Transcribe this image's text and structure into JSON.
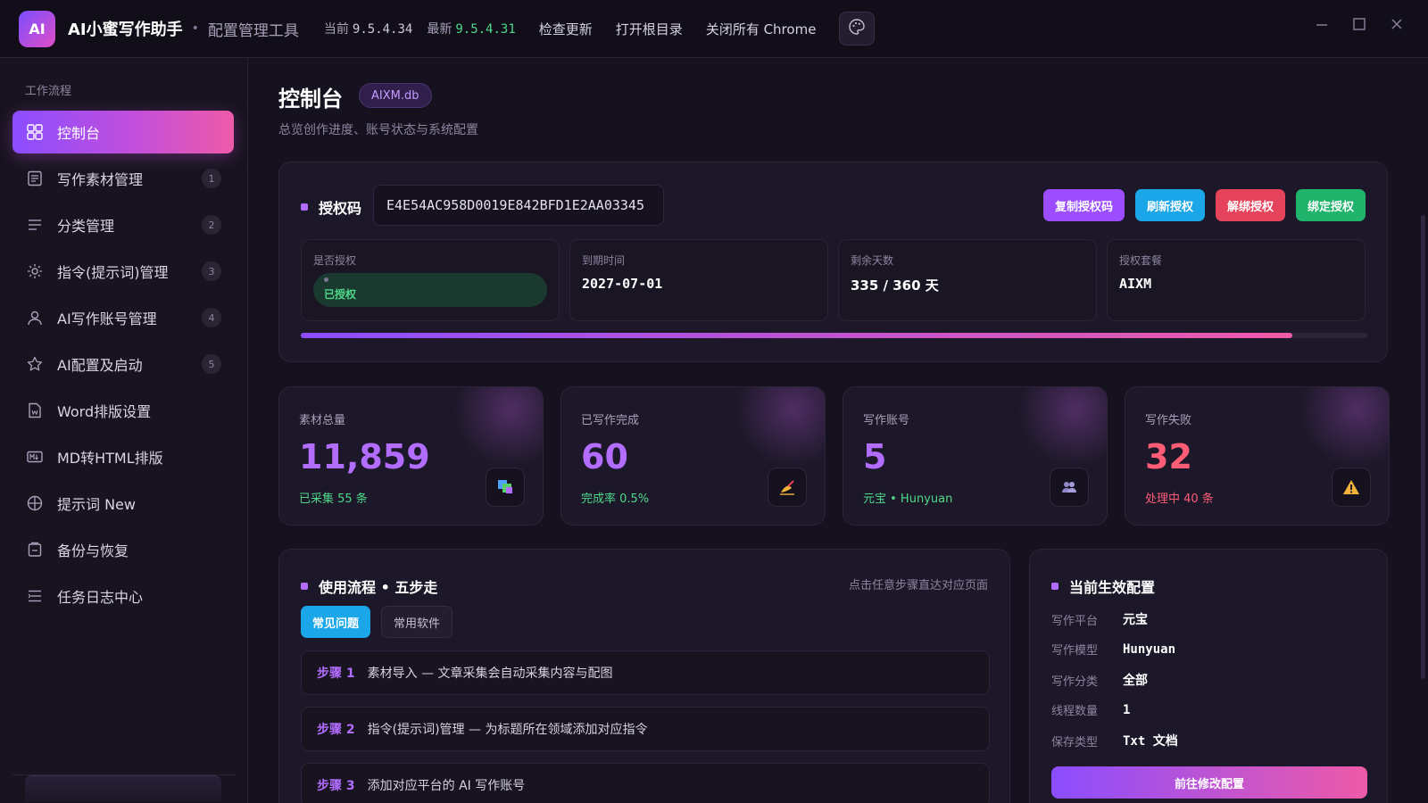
{
  "titlebar": {
    "logo_text": "AI",
    "app_name": "AI小蜜写作助手",
    "separator": "•",
    "app_subtitle": "配置管理工具",
    "current_label": "当前",
    "current_version": "9.5.4.34",
    "latest_label": "最新",
    "latest_version": "9.5.4.31",
    "links": [
      "检查更新",
      "打开根目录",
      "关闭所有 Chrome"
    ],
    "palette_icon": "palette-icon",
    "window_controls": [
      "minimize-icon",
      "maximize-icon",
      "close-icon"
    ]
  },
  "sidebar": {
    "section_label": "工作流程",
    "items": [
      {
        "label": "控制台",
        "badge": "",
        "icon": "dashboard-icon",
        "active": true
      },
      {
        "label": "写作素材管理",
        "badge": "1",
        "icon": "document-icon"
      },
      {
        "label": "分类管理",
        "badge": "2",
        "icon": "list-icon"
      },
      {
        "label": "指令(提示词)管理",
        "badge": "3",
        "icon": "gear-icon"
      },
      {
        "label": "AI写作账号管理",
        "badge": "4",
        "icon": "user-icon"
      },
      {
        "label": "AI配置及启动",
        "badge": "5",
        "icon": "star-icon"
      },
      {
        "label": "Word排版设置",
        "badge": "",
        "icon": "file-icon"
      },
      {
        "label": "MD转HTML排版",
        "badge": "",
        "icon": "markdown-icon"
      },
      {
        "label": "提示词 New",
        "badge": "",
        "icon": "globe-icon"
      },
      {
        "label": "备份与恢复",
        "badge": "",
        "icon": "backup-icon"
      },
      {
        "label": "任务日志中心",
        "badge": "",
        "icon": "log-icon"
      }
    ]
  },
  "page": {
    "title": "控制台",
    "db_badge": "AIXM.db",
    "subtitle": "总览创作进度、账号状态与系统配置"
  },
  "license": {
    "label": "授权码",
    "code": "E4E54AC958D0019E842BFD1E2AA03345",
    "buttons": [
      "复制授权码",
      "刷新授权",
      "解绑授权",
      "绑定授权"
    ],
    "status_label": "是否授权",
    "status_value": "已授权",
    "expire_label": "到期时间",
    "expire_value": "2027-07-01",
    "days_label": "剩余天数",
    "days_value": "335 / 360 天",
    "plan_label": "授权套餐",
    "plan_value": "AIXM",
    "progress": 0.93
  },
  "stats": [
    {
      "label": "素材总量",
      "value": "11,859",
      "sub": "已采集 55 条",
      "icon": "materials-icon",
      "tone": "green"
    },
    {
      "label": "已写作完成",
      "value": "60",
      "sub": "完成率 0.5%",
      "icon": "writing-hand-icon",
      "tone": "green"
    },
    {
      "label": "写作账号",
      "value": "5",
      "sub": "元宝 • Hunyuan",
      "icon": "users-icon",
      "tone": "green"
    },
    {
      "label": "写作失败",
      "value": "32",
      "sub": "处理中 40 条",
      "icon": "warning-icon",
      "tone": "red"
    }
  ],
  "workflow": {
    "title": "使用流程 • 五步走",
    "hint": "点击任意步骤直达对应页面",
    "tabs": [
      "常见问题",
      "常用软件"
    ],
    "steps": [
      {
        "num": "步骤 1",
        "text": "素材导入 — 文章采集会自动采集内容与配图"
      },
      {
        "num": "步骤 2",
        "text": "指令(提示词)管理 — 为标题所在领域添加对应指令"
      },
      {
        "num": "步骤 3",
        "text": "添加对应平台的 AI 写作账号"
      }
    ]
  },
  "config": {
    "title": "当前生效配置",
    "rows": [
      {
        "key": "写作平台",
        "value": "元宝"
      },
      {
        "key": "写作模型",
        "value": "Hunyuan"
      },
      {
        "key": "写作分类",
        "value": "全部"
      },
      {
        "key": "线程数量",
        "value": "1"
      },
      {
        "key": "保存类型",
        "value": "Txt 文档"
      }
    ],
    "button": "前往修改配置"
  },
  "colors": {
    "accent_purple": "#b26dff",
    "accent_pink": "#ee5aa8",
    "success": "#4fd88a",
    "danger": "#ff5c76",
    "background": "#15111e"
  }
}
